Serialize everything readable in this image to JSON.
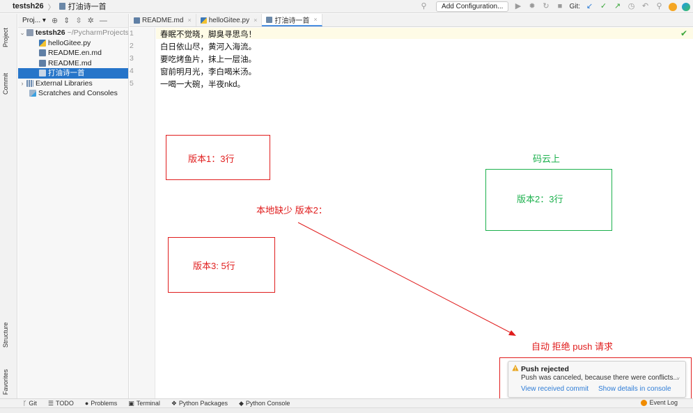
{
  "navbar": {
    "project": "testsh26",
    "file": "打油诗一首",
    "add_config": "Add Configuration...",
    "git_label": "Git:"
  },
  "stripe": {
    "project": "Project",
    "commit": "Commit",
    "structure": "Structure",
    "favorites": "Favorites"
  },
  "project_panel": {
    "title": "Proj...",
    "root": {
      "name": "testsh26",
      "path": "~/PycharmProjects"
    },
    "files": [
      {
        "name": "helloGitee.py"
      },
      {
        "name": "README.en.md"
      },
      {
        "name": "README.md"
      },
      {
        "name": "打油诗一首"
      }
    ],
    "external_libraries": "External Libraries",
    "scratches": "Scratches and Consoles"
  },
  "tabs": [
    {
      "label": "README.md"
    },
    {
      "label": "helloGitee.py"
    },
    {
      "label": "打油诗一首"
    }
  ],
  "editor": {
    "line_numbers": [
      "1",
      "2",
      "3",
      "4",
      "5"
    ],
    "lines": [
      "春眠不觉晓，脚臭寻思鸟！",
      "白日依山尽，黄河入海流。",
      "要吃烤鱼片，抹上一层油。",
      "窗前明月光，李白喝米汤。",
      "一喝一大碗，半夜nkd。"
    ]
  },
  "annotations": {
    "version1": "版本1：3行",
    "version3": "版本3: 5行",
    "local_missing": "本地缺少 版本2：",
    "cloud_title": "码云上",
    "version2": "版本2：3行",
    "auto_reject": "自动 拒绝 push 请求"
  },
  "notification": {
    "title": "Push rejected",
    "body": "Push was canceled, because there were conflicts...",
    "link1": "View received commit",
    "link2": "Show details in console"
  },
  "bottom_tools": [
    {
      "label": "Git"
    },
    {
      "label": "TODO"
    },
    {
      "label": "Problems"
    },
    {
      "label": "Terminal"
    },
    {
      "label": "Python Packages"
    },
    {
      "label": "Python Console"
    }
  ],
  "event_log": "Event Log",
  "colors": {
    "annotation_red": "#e01c1c",
    "annotation_green": "#1bb04c",
    "selection_blue": "#2675c9"
  }
}
